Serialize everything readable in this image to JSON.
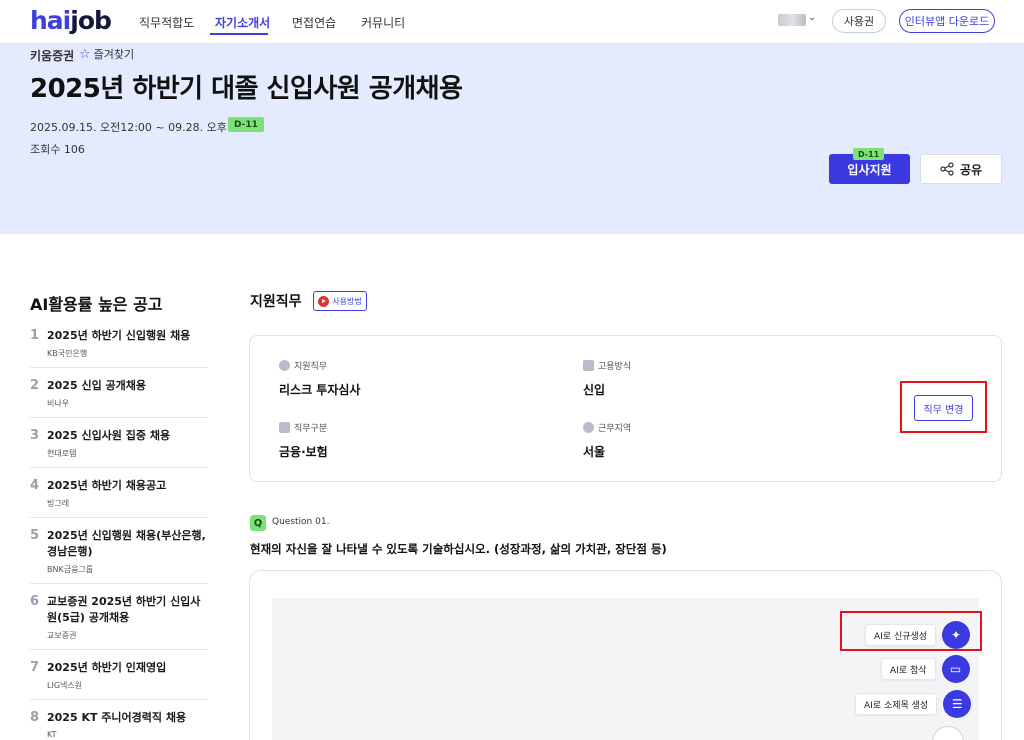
{
  "header": {
    "logo_a": "hai",
    "logo_b": "job",
    "nav": [
      "직무적합도",
      "자기소개서",
      "면접연습",
      "커뮤니티"
    ],
    "ticket_label": "사용권",
    "download_label": "인터뷰앱 다운로드"
  },
  "hero": {
    "company": "키움증권",
    "favorite_label": "즐겨찾기",
    "title": "2025년 하반기 대졸 신입사원 공개채용",
    "period": "2025.09.15. 오전12:00 ~ 09.28. 오후11:00",
    "dday": "D-11",
    "views": "조회수 106",
    "apply_label": "입사지원",
    "apply_dday": "D-11",
    "share_label": "공유"
  },
  "sidebar": {
    "title": "AI활용률 높은 공고",
    "items": [
      {
        "num": "1",
        "title": "2025년 하반기 신입행원 채용",
        "company": "KB국민은행"
      },
      {
        "num": "2",
        "title": "2025 신입 공개채용",
        "company": "비나우"
      },
      {
        "num": "3",
        "title": "2025 신입사원 집중 채용",
        "company": "현대로템"
      },
      {
        "num": "4",
        "title": "2025년 하반기 채용공고",
        "company": "빙그레"
      },
      {
        "num": "5",
        "title": "2025년 신입행원 채용(부산은행, 경남은행)",
        "company": "BNK금융그룹"
      },
      {
        "num": "6",
        "title": "교보증권 2025년 하반기 신입사원(5급) 공개채용",
        "company": "교보증권"
      },
      {
        "num": "7",
        "title": "2025년 하반기 인재영입",
        "company": "LIG넥스원"
      },
      {
        "num": "8",
        "title": "2025 KT 주니어경력직 채용",
        "company": "KT"
      }
    ]
  },
  "job": {
    "section_title": "지원직무",
    "howto_label": "사용방법",
    "fields": {
      "job_label": "지원직무",
      "job_value": "리스크 투자심사",
      "type_label": "고용방식",
      "type_value": "신입",
      "category_label": "직무구분",
      "category_value": "금융·보험",
      "location_label": "근무지역",
      "location_value": "서울"
    },
    "change_label": "직무 변경"
  },
  "question": {
    "badge": "Q",
    "number": "Question 01.",
    "text": "현재의 자신을 잘 나타낼 수 있도록 기술하십시오. (성장과정, 삶의 가치관, 장단점 등)"
  },
  "ai_tools": {
    "generate": "AI로 신규생성",
    "revise": "AI로 첨삭",
    "subtitle": "AI로 소제목 생성"
  },
  "colors": {
    "accent": "#3a3ae0",
    "hero_bg": "#e5ebff",
    "dday": "#7fe07a",
    "highlight": "#e0141b"
  }
}
